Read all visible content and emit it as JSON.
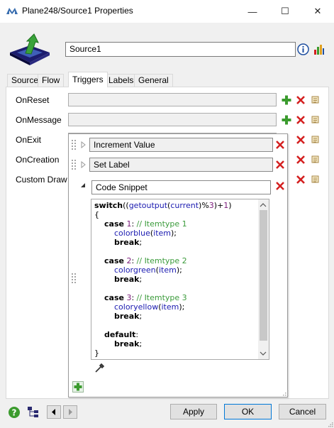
{
  "window": {
    "title": "Plane248/Source1  Properties",
    "minimize_glyph": "—",
    "maximize_glyph": "☐",
    "close_glyph": "✕"
  },
  "object_name": "Source1",
  "tabs": [
    {
      "label": "Source"
    },
    {
      "label": "Flow"
    },
    {
      "label": "Triggers"
    },
    {
      "label": "Labels"
    },
    {
      "label": "General"
    }
  ],
  "active_tab": "Triggers",
  "triggers": [
    {
      "label": "OnReset"
    },
    {
      "label": "OnMessage"
    },
    {
      "label": "OnExit"
    },
    {
      "label": "OnCreation"
    },
    {
      "label": "Custom Draw"
    }
  ],
  "popup": {
    "items": [
      {
        "label": "Increment Value"
      },
      {
        "label": "Set Label"
      },
      {
        "label": "Code Snippet"
      }
    ],
    "code_lines": [
      "switch((getoutput(current)%3)+1)",
      "{",
      "    case 1: // Itemtype 1",
      "        colorblue(item);",
      "        break;",
      "",
      "    case 2: // Itemtype 2",
      "        colorgreen(item);",
      "        break;",
      "",
      "    case 3: // Itemtype 3",
      "        coloryellow(item);",
      "        break;",
      "",
      "    default:",
      "        break;",
      "}"
    ]
  },
  "buttons": {
    "apply": "Apply",
    "ok": "OK",
    "cancel": "Cancel"
  },
  "icons": {
    "add": "plus-icon",
    "remove": "red-x-icon",
    "edit": "script-icon",
    "help": "help-icon",
    "info": "info-icon",
    "chart": "chart-icon",
    "tree": "tree-icon",
    "eyedropper": "eyedropper-icon"
  },
  "colors": {
    "plus_green": "#3b9b2e",
    "x_red": "#d42020",
    "accent_blue": "#0078d7"
  }
}
